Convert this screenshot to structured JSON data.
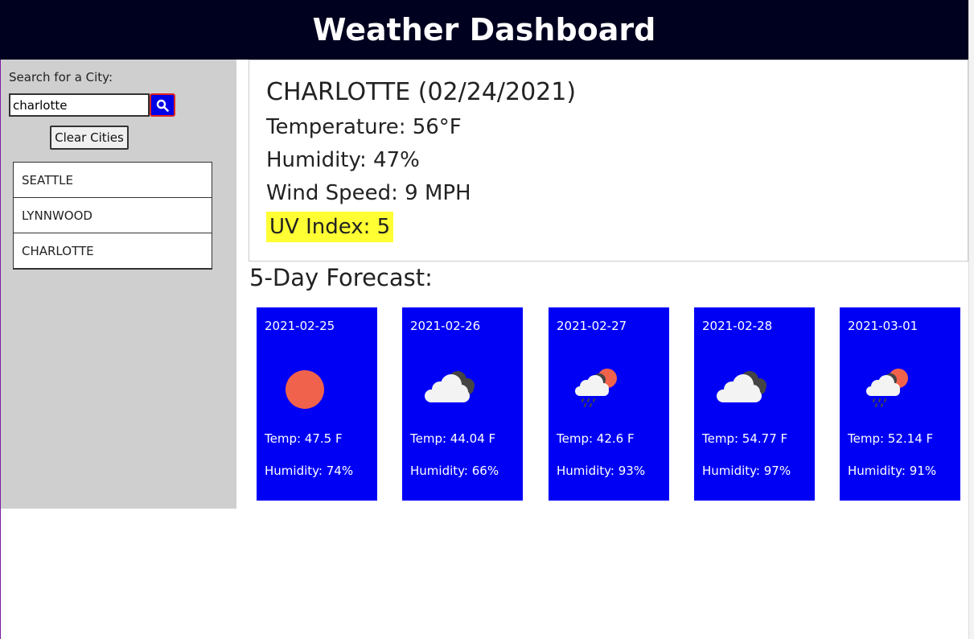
{
  "header": {
    "title": "Weather Dashboard"
  },
  "sidebar": {
    "search_label": "Search for a City:",
    "search_value": "charlotte",
    "search_icon": "search-icon",
    "clear_label": "Clear Cities",
    "cities": [
      "SEATTLE",
      "LYNNWOOD",
      "CHARLOTTE"
    ]
  },
  "current": {
    "title": "CHARLOTTE (02/24/2021)",
    "temperature": "Temperature: 56°F",
    "humidity": "Humidity: 47%",
    "wind": "Wind Speed: 9 MPH",
    "uv": "UV Index: 5",
    "uv_color": "#ffff33"
  },
  "forecast": {
    "title": "5-Day Forecast:",
    "card_color": "#0000f5",
    "days": [
      {
        "date": "2021-02-25",
        "icon": "sun-icon",
        "temp": "Temp: 47.5 F",
        "humidity": "Humidity: 74%"
      },
      {
        "date": "2021-02-26",
        "icon": "cloud-icon",
        "temp": "Temp: 44.04 F",
        "humidity": "Humidity: 66%"
      },
      {
        "date": "2021-02-27",
        "icon": "rain-sun-icon",
        "temp": "Temp: 42.6 F",
        "humidity": "Humidity: 93%"
      },
      {
        "date": "2021-02-28",
        "icon": "cloud-icon",
        "temp": "Temp: 54.77 F",
        "humidity": "Humidity: 97%"
      },
      {
        "date": "2021-03-01",
        "icon": "rain-sun-icon",
        "temp": "Temp: 52.14 F",
        "humidity": "Humidity: 91%"
      }
    ]
  }
}
